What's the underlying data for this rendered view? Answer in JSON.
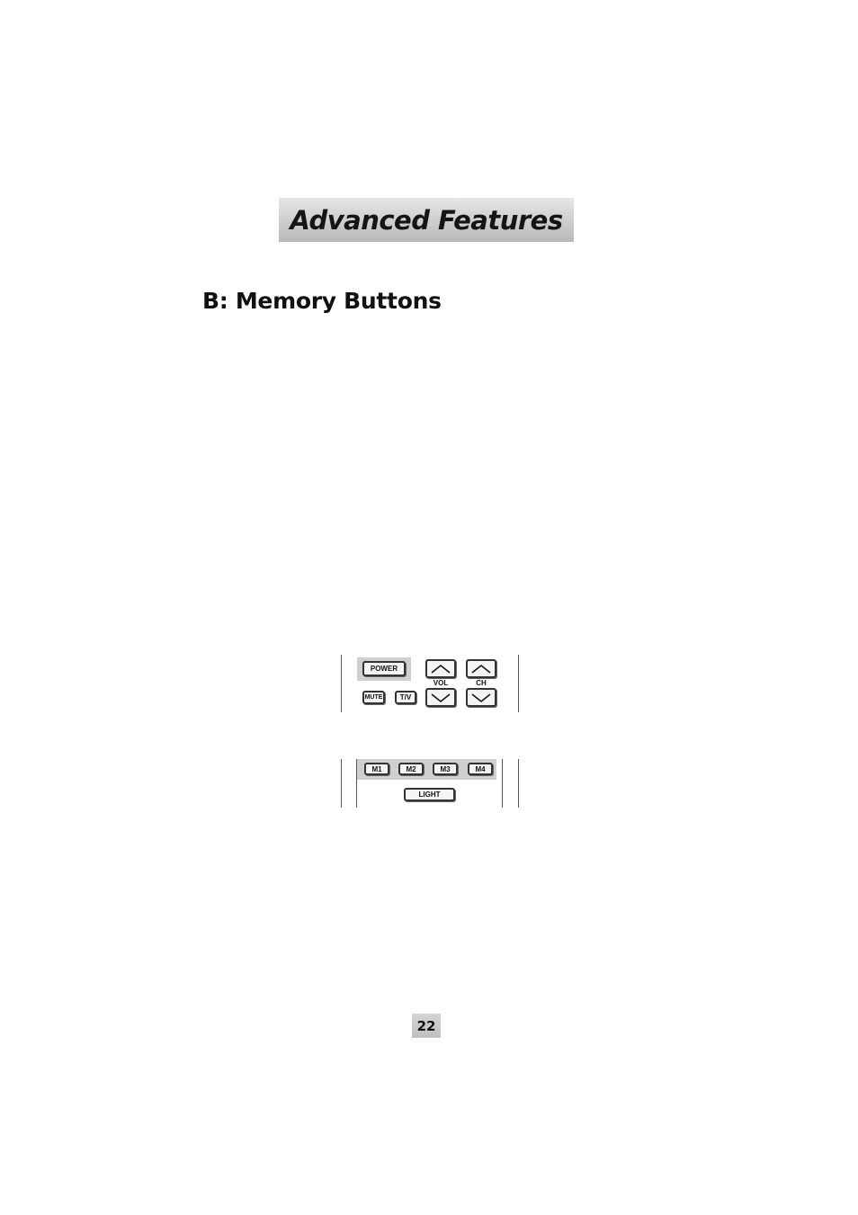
{
  "header": {
    "banner_title": "Advanced Features"
  },
  "section": {
    "title": "B: Memory Buttons"
  },
  "remote_top": {
    "power": "POWER",
    "mute": "MUTE",
    "tv": "T/V",
    "vol_label": "VOL",
    "ch_label": "CH",
    "vol_up_icon": "chevron-up",
    "vol_down_icon": "chevron-down",
    "ch_up_icon": "chevron-up",
    "ch_down_icon": "chevron-down"
  },
  "remote_bottom": {
    "memory_buttons": [
      "M1",
      "M2",
      "M3",
      "M4"
    ],
    "light": "LIGHT"
  },
  "footer": {
    "page_number": "22"
  }
}
